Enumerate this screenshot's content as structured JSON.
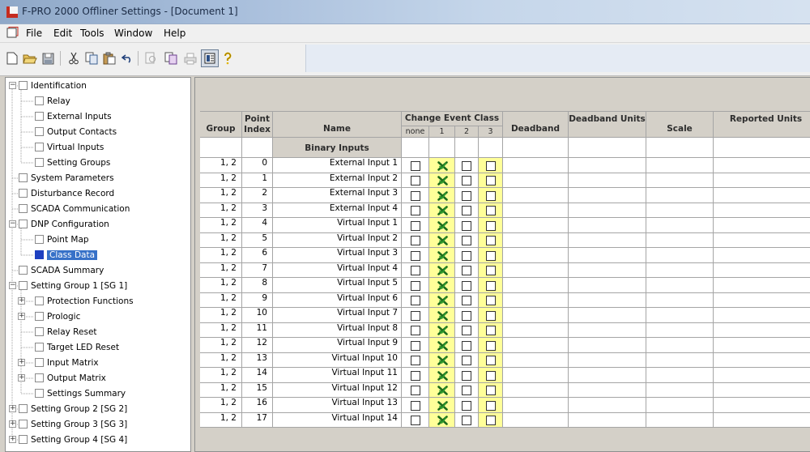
{
  "window": {
    "title": "F-PRO 2000 Offliner Settings - [Document 1]"
  },
  "menu": [
    "File",
    "Edit",
    "Tools",
    "Window",
    "Help"
  ],
  "toolbar": {
    "icons": [
      "new-icon",
      "open-icon",
      "save-icon",
      "cut-icon",
      "copy-icon",
      "paste-icon",
      "undo-icon",
      "print-preview-icon",
      "copy-alt-icon",
      "print-icon",
      "document-view-icon",
      "help-icon"
    ],
    "active": "document-view-icon"
  },
  "tree": [
    {
      "label": "Identification",
      "depth": 0,
      "expander": "minus"
    },
    {
      "label": "Relay",
      "depth": 1
    },
    {
      "label": "External Inputs",
      "depth": 1
    },
    {
      "label": "Output Contacts",
      "depth": 1
    },
    {
      "label": "Virtual Inputs",
      "depth": 1
    },
    {
      "label": "Setting Groups",
      "depth": 1
    },
    {
      "label": "System Parameters",
      "depth": 0
    },
    {
      "label": "Disturbance Record",
      "depth": 0
    },
    {
      "label": "SCADA Communication",
      "depth": 0
    },
    {
      "label": "DNP Configuration",
      "depth": 0,
      "expander": "minus"
    },
    {
      "label": "Point Map",
      "depth": 1
    },
    {
      "label": "Class Data",
      "depth": 1,
      "selected": true
    },
    {
      "label": "SCADA Summary",
      "depth": 0
    },
    {
      "label": "Setting Group 1 [SG 1]",
      "depth": 0,
      "expander": "minus"
    },
    {
      "label": "Protection Functions",
      "depth": 1,
      "expander": "plus"
    },
    {
      "label": "Prologic",
      "depth": 1,
      "expander": "plus"
    },
    {
      "label": "Relay Reset",
      "depth": 1
    },
    {
      "label": "Target LED Reset",
      "depth": 1
    },
    {
      "label": "Input Matrix",
      "depth": 1,
      "expander": "plus"
    },
    {
      "label": "Output Matrix",
      "depth": 1,
      "expander": "plus"
    },
    {
      "label": "Settings Summary",
      "depth": 1
    },
    {
      "label": "Setting Group 2 [SG 2]",
      "depth": 0,
      "expander": "plus"
    },
    {
      "label": "Setting Group 3 [SG 3]",
      "depth": 0,
      "expander": "plus"
    },
    {
      "label": "Setting Group 4 [SG 4]",
      "depth": 0,
      "expander": "plus"
    }
  ],
  "table": {
    "headers": {
      "group": "Group",
      "point_index": "Point Index",
      "name": "Name",
      "change_event_class": "Change Event Class",
      "deadband": "Deadband",
      "deadband_units": "Deadband Units",
      "scale": "Scale",
      "reported_units": "Reported Units"
    },
    "class_columns": [
      "none",
      "1",
      "2",
      "3"
    ],
    "section_label": "Binary Inputs",
    "rows": [
      {
        "group": "1, 2",
        "index": "0",
        "name": "External Input 1",
        "class": "1"
      },
      {
        "group": "1, 2",
        "index": "1",
        "name": "External Input 2",
        "class": "1"
      },
      {
        "group": "1, 2",
        "index": "2",
        "name": "External Input 3",
        "class": "1"
      },
      {
        "group": "1, 2",
        "index": "3",
        "name": "External Input 4",
        "class": "1"
      },
      {
        "group": "1, 2",
        "index": "4",
        "name": "Virtual Input 1",
        "class": "1"
      },
      {
        "group": "1, 2",
        "index": "5",
        "name": "Virtual Input 2",
        "class": "1"
      },
      {
        "group": "1, 2",
        "index": "6",
        "name": "Virtual Input 3",
        "class": "1"
      },
      {
        "group": "1, 2",
        "index": "7",
        "name": "Virtual Input 4",
        "class": "1"
      },
      {
        "group": "1, 2",
        "index": "8",
        "name": "Virtual Input 5",
        "class": "1"
      },
      {
        "group": "1, 2",
        "index": "9",
        "name": "Virtual Input 6",
        "class": "1"
      },
      {
        "group": "1, 2",
        "index": "10",
        "name": "Virtual Input 7",
        "class": "1"
      },
      {
        "group": "1, 2",
        "index": "11",
        "name": "Virtual Input 8",
        "class": "1"
      },
      {
        "group": "1, 2",
        "index": "12",
        "name": "Virtual Input 9",
        "class": "1"
      },
      {
        "group": "1, 2",
        "index": "13",
        "name": "Virtual Input 10",
        "class": "1"
      },
      {
        "group": "1, 2",
        "index": "14",
        "name": "Virtual Input 11",
        "class": "1"
      },
      {
        "group": "1, 2",
        "index": "15",
        "name": "Virtual Input 12",
        "class": "1"
      },
      {
        "group": "1, 2",
        "index": "16",
        "name": "Virtual Input 13",
        "class": "1"
      },
      {
        "group": "1, 2",
        "index": "17",
        "name": "Virtual Input 14",
        "class": "1"
      }
    ]
  },
  "colors": {
    "highlight_column": "#ffff99",
    "check_mark": "#2e9e2e",
    "check_x": "#1d6b1d",
    "selection": "#3771c8"
  }
}
